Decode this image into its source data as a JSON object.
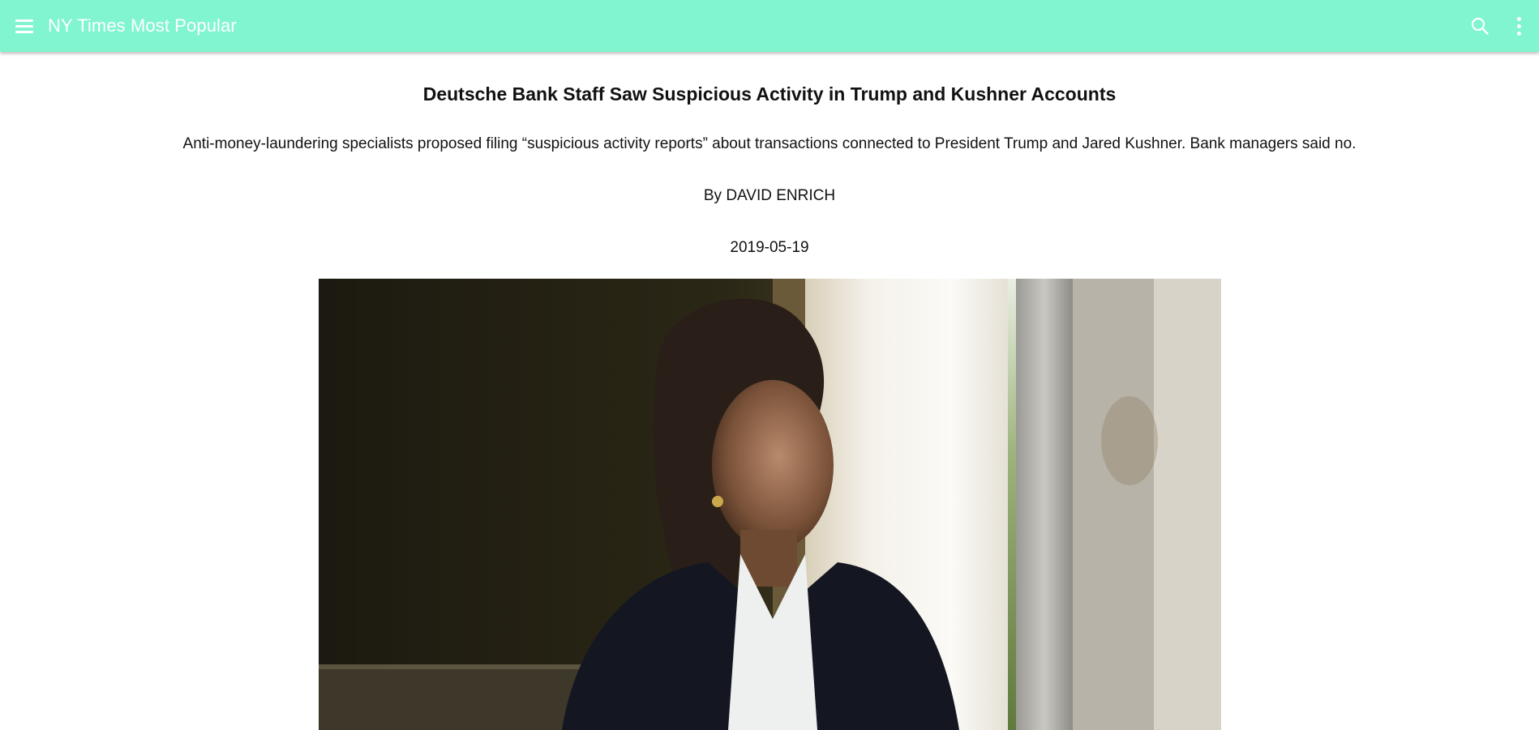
{
  "appbar": {
    "title": "NY Times Most Popular",
    "menu_icon": "hamburger-menu-icon",
    "search_icon": "search-icon",
    "more_icon": "more-vertical-icon",
    "color": "#80f5d0"
  },
  "article": {
    "title": "Deutsche Bank Staff Saw Suspicious Activity in Trump and Kushner Accounts",
    "abstract": "Anti-money-laundering specialists proposed filing “suspicious activity reports” about transactions connected to President Trump and Jared Kushner. Bank managers said no.",
    "byline": "By DAVID ENRICH",
    "published_date": "2019-05-19"
  }
}
